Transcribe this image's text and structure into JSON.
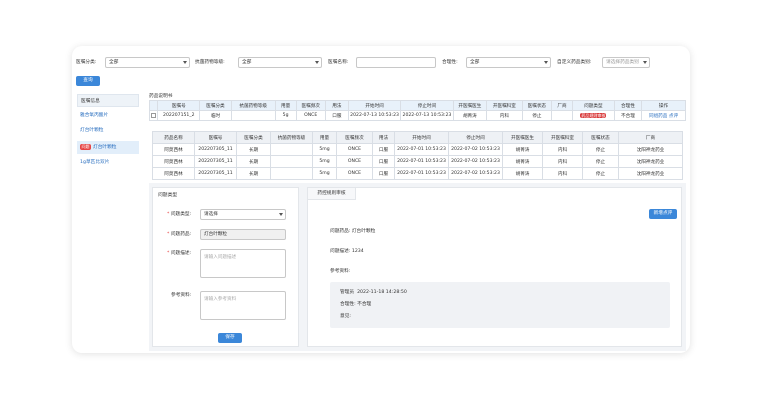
{
  "filters": {
    "category_label": "医嘱分类:",
    "category_value": "全部",
    "antibiotic_label": "抗菌药物等级:",
    "antibiotic_value": "全部",
    "name_label": "医嘱名称:",
    "name_value": "",
    "reasonable_label": "合理性:",
    "reasonable_value": "全部",
    "custom_label": "自定义药品类别:",
    "custom_placeholder": "请选择药品类别",
    "query_button": "查询"
  },
  "sidebar": {
    "header": "医嘱信息",
    "items": [
      {
        "label": "雅合氧丙酸片",
        "badge": ""
      },
      {
        "label": "灯台叶颗粒",
        "badge": ""
      },
      {
        "label": "灯台叶颗粒",
        "badge": "问题"
      },
      {
        "label": "1g草匹比双片",
        "badge": ""
      }
    ]
  },
  "main": {
    "section_title": "药品说明书",
    "order_table": {
      "headers": [
        "",
        "医嘱号",
        "医嘱分类",
        "抗菌药物等级",
        "用量",
        "医嘱频次",
        "用法",
        "开始时间",
        "停止时间",
        "开医嘱医生",
        "开医嘱科室",
        "医嘱状态",
        "厂商",
        "问题类型",
        "合理性",
        "操作"
      ],
      "row": {
        "order_no": "202207151_2",
        "category": "临时",
        "level": "",
        "dose": "5g",
        "freq": "ONCE",
        "usage": "口服",
        "start": "2022-07-13 10:53:23",
        "stop": "2022-07-13 10:53:23",
        "doctor": "胡菁涛",
        "dept": "内科",
        "status": "停止",
        "vendor": "",
        "problem": "药品规则审核",
        "reasonable": "不合理",
        "op1": "同组药品",
        "op2": "点评"
      }
    },
    "drug_table": {
      "headers": [
        "药品名称",
        "医嘱号",
        "医嘱分类",
        "抗菌药物等级",
        "用量",
        "医嘱频次",
        "用法",
        "开始时间",
        "停止时间",
        "开医嘱医生",
        "开医嘱科室",
        "医嘱状态",
        "厂商"
      ],
      "rows": [
        {
          "name": "阿莫西林",
          "order_no": "202207305_11",
          "category": "长期",
          "level": "",
          "dose": "5mg",
          "freq": "ONCE",
          "usage": "口服",
          "start": "2022-07-01 10:53:23",
          "stop": "2022-07-02 10:53:23",
          "doctor": "胡菁涛",
          "dept": "内科",
          "status": "停止",
          "vendor": "沈阳神龙药业"
        },
        {
          "name": "阿莫西林",
          "order_no": "202207305_11",
          "category": "长期",
          "level": "",
          "dose": "5mg",
          "freq": "ONCE",
          "usage": "口服",
          "start": "2022-07-01 10:53:23",
          "stop": "2022-07-02 10:53:23",
          "doctor": "胡菁涛",
          "dept": "内科",
          "status": "停止",
          "vendor": "沈阳神龙药业"
        },
        {
          "name": "阿莫西林",
          "order_no": "202207305_11",
          "category": "长期",
          "level": "",
          "dose": "5mg",
          "freq": "ONCE",
          "usage": "口服",
          "start": "2022-07-01 10:53:23",
          "stop": "2022-07-02 10:53:23",
          "doctor": "胡菁涛",
          "dept": "内科",
          "status": "停止",
          "vendor": "沈阳神龙药业"
        }
      ]
    }
  },
  "problem_form": {
    "title": "问题类型",
    "type_label": "问题类型:",
    "type_value": "请选择",
    "drug_label": "问题药品:",
    "drug_value": "灯台叶颗粒",
    "desc_label": "问题描述:",
    "desc_placeholder": "请输入问题描述",
    "ref_label": "参考资料:",
    "ref_placeholder": "请输入参考资料",
    "save_button": "保存"
  },
  "review": {
    "tab": "药控规则审核",
    "add_button": "新增点评",
    "drug_label": "问题药品:",
    "drug_value": "灯台叶颗粒",
    "desc_label": "问题描述:",
    "desc_value": "1234",
    "ref_label": "参考资料:",
    "comment_user": "管理员",
    "comment_time": "2022-11-18 14:28:50",
    "reasonable_label": "合理性:",
    "reasonable_value": "不合理",
    "opinion_label": "意见:"
  }
}
